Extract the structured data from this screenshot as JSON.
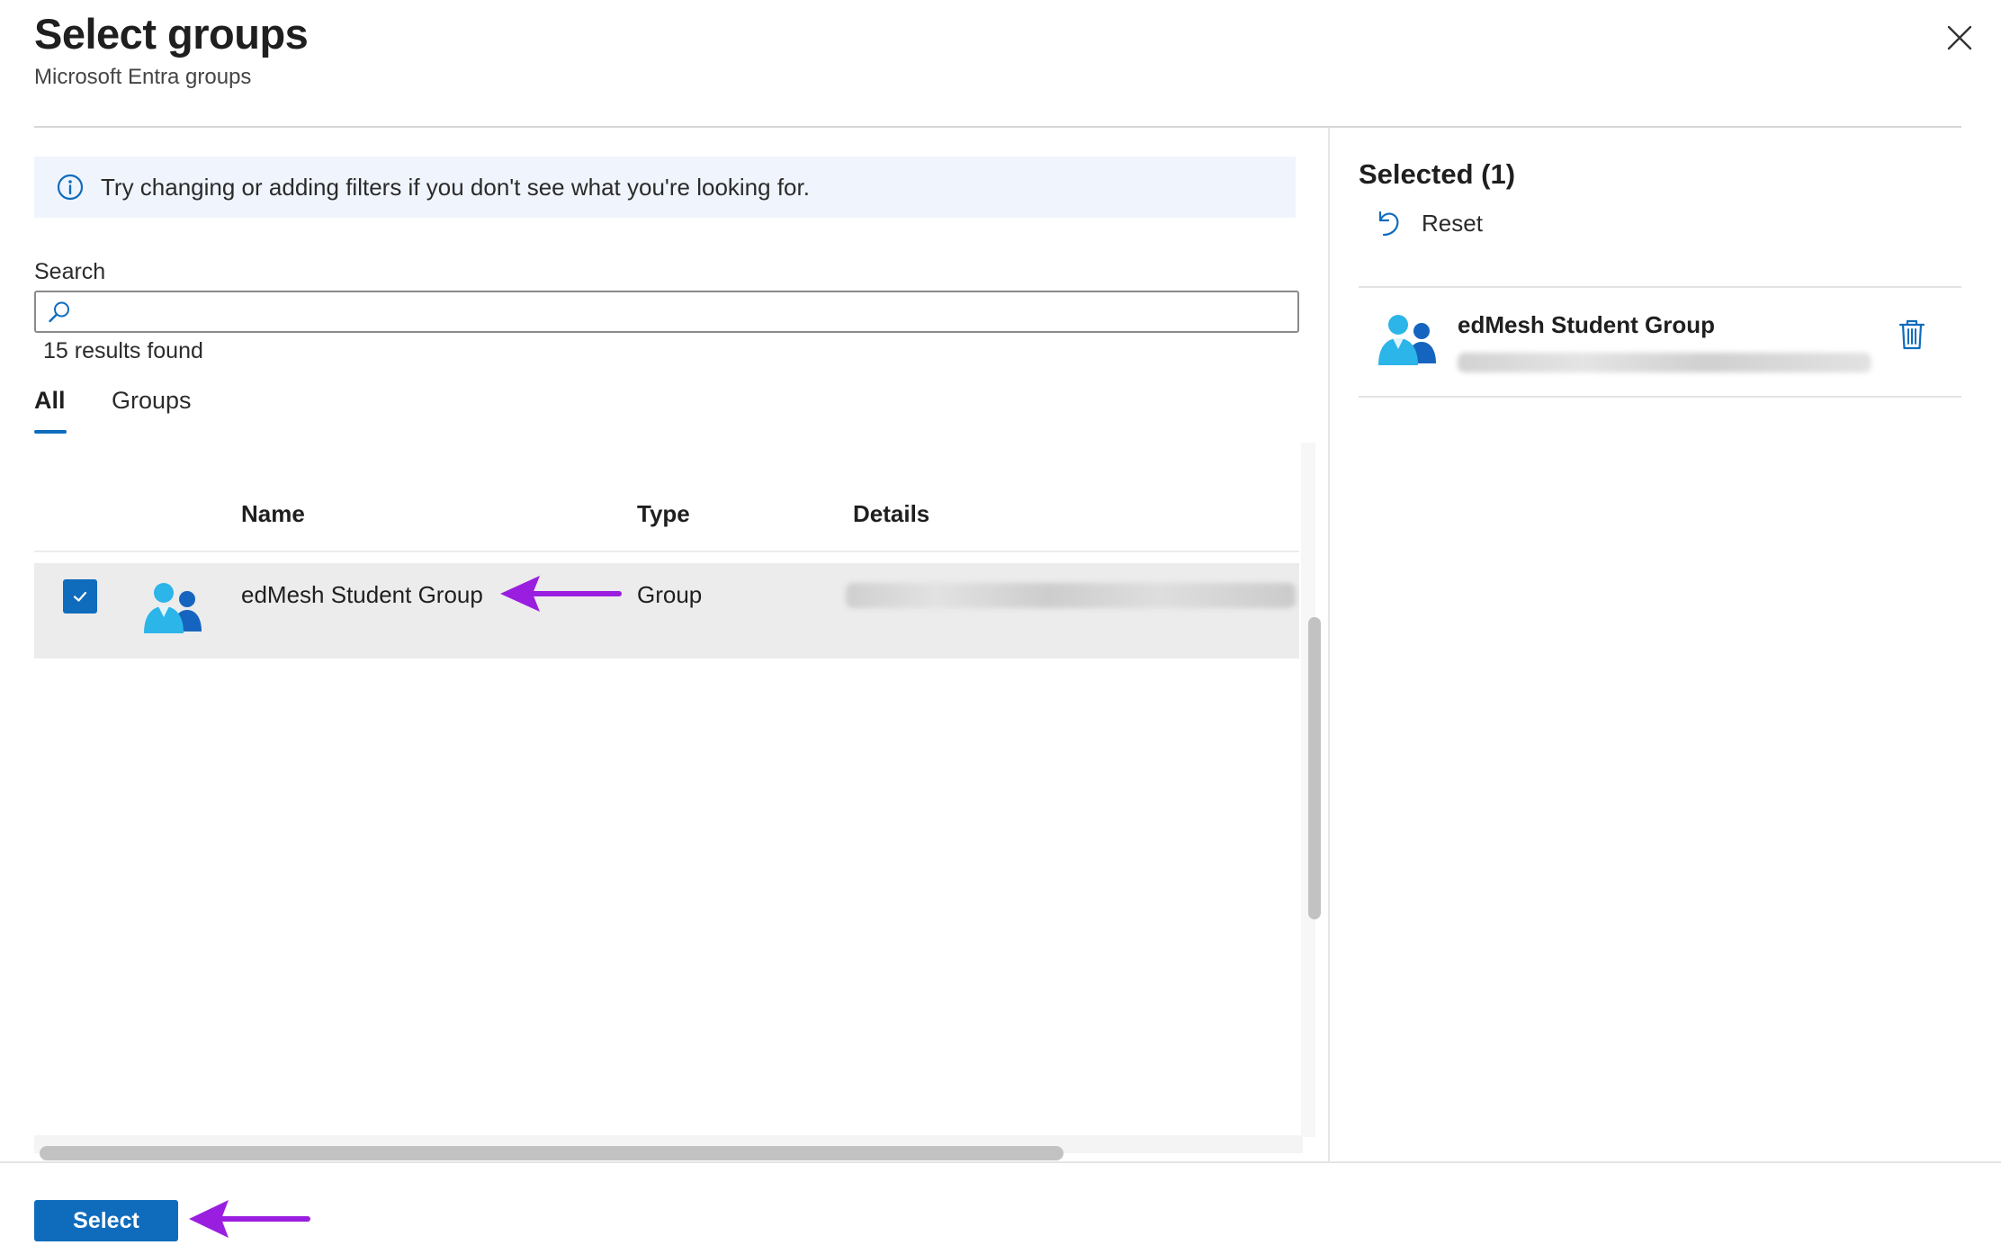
{
  "header": {
    "title": "Select groups",
    "subtitle": "Microsoft Entra groups"
  },
  "info": {
    "message": "Try changing or adding filters if you don't see what you're looking for."
  },
  "search": {
    "label": "Search",
    "value": "",
    "placeholder": "",
    "results": "15 results found"
  },
  "tabs": [
    {
      "label": "All",
      "active": true
    },
    {
      "label": "Groups",
      "active": false
    }
  ],
  "table": {
    "columns": [
      "Name",
      "Type",
      "Details"
    ],
    "rows": [
      {
        "name": "edMesh Student Group",
        "type": "Group",
        "checked": true
      }
    ]
  },
  "selected_panel": {
    "title": "Selected (1)",
    "reset_label": "Reset",
    "items": [
      {
        "name": "edMesh Student Group"
      }
    ]
  },
  "footer": {
    "select_label": "Select"
  },
  "colors": {
    "accent": "#0f6cbd",
    "annotation_arrow": "#9a1ee0",
    "info_bg": "#f0f5fd",
    "row_selected_bg": "#ececec"
  },
  "icons": {
    "close": "close-icon",
    "info": "info-icon",
    "search": "search-icon",
    "checkmark": "checkmark-icon",
    "group": "group-icon",
    "reset": "undo-icon",
    "delete": "trash-icon"
  }
}
